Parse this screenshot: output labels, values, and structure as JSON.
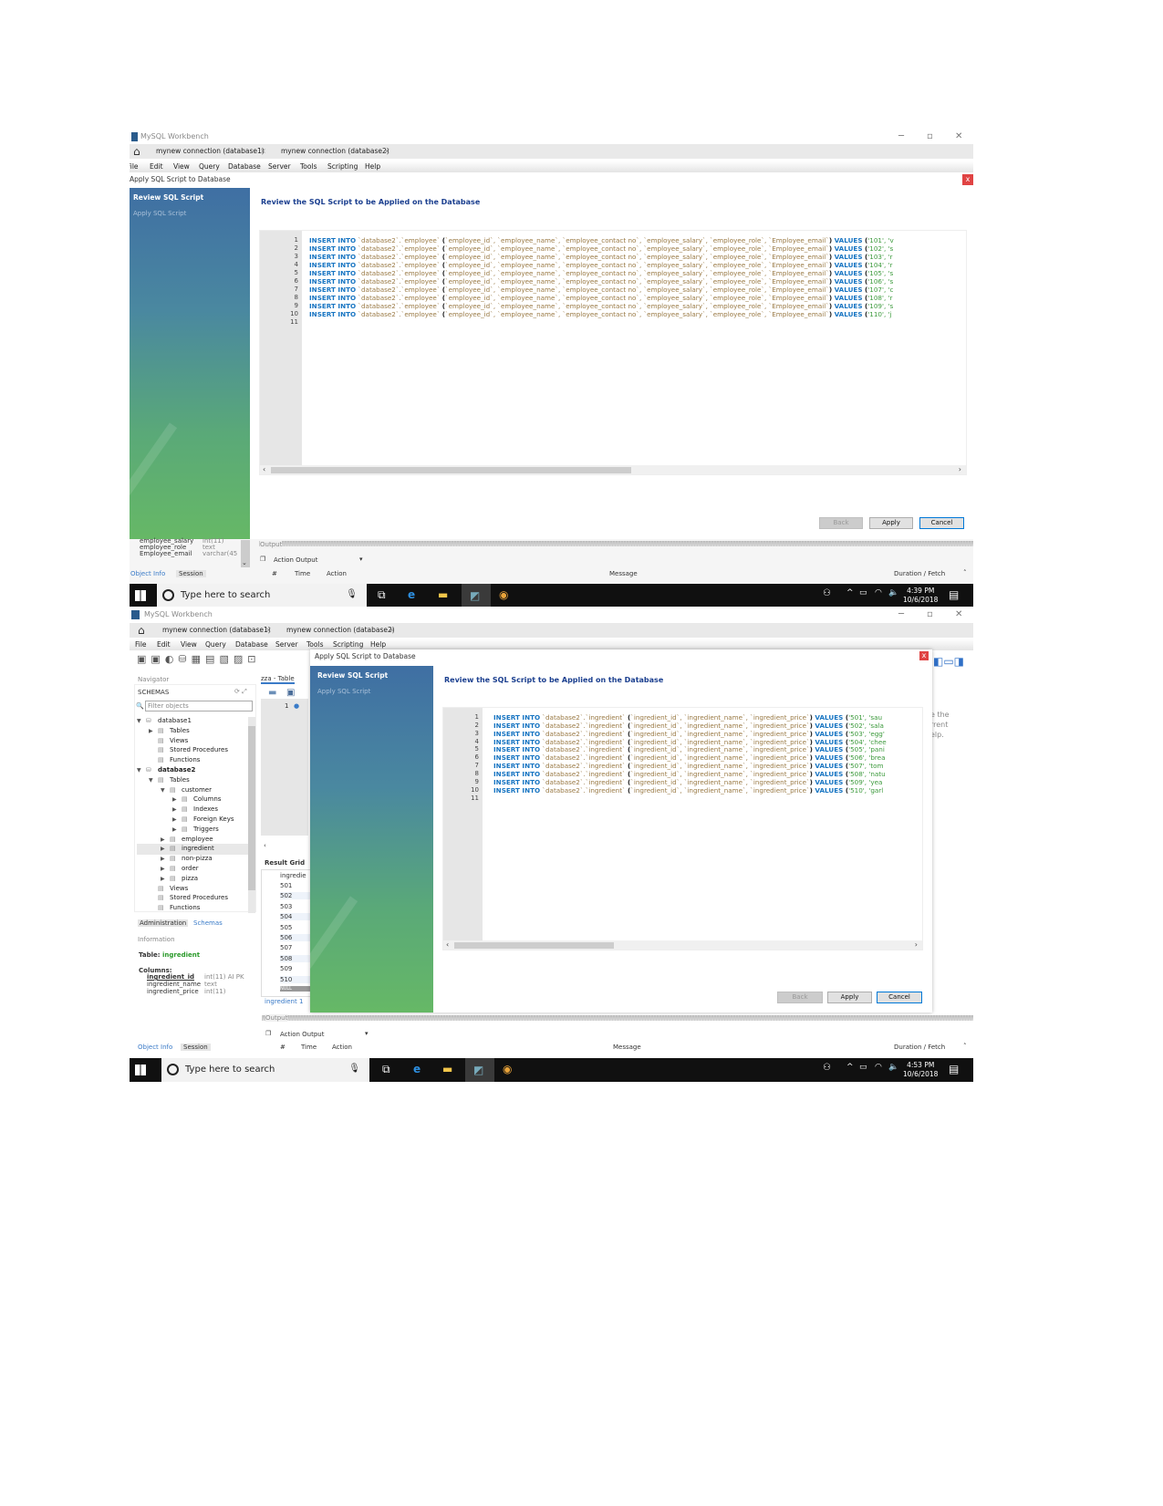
{
  "screenshots": [
    {
      "window_title": "MySQL Workbench",
      "tabs": [
        "mynew connection (database1)",
        "mynew connection (database2)"
      ],
      "menu": [
        "File",
        "Edit",
        "View",
        "Query",
        "Database",
        "Server",
        "Tools",
        "Scripting",
        "Help"
      ],
      "dialog": {
        "title": "Apply SQL Script to Database",
        "steps": [
          "Review SQL Script",
          "Apply SQL Script"
        ],
        "heading": "Review the SQL Script to be Applied on the Database",
        "code": {
          "lines": [
            {
              "n": "1",
              "kw": "INSERT INTO",
              "target": " `database2`.`employee` ",
              "cols": "`employee_id`, `employee_name`, `employee_contact no`, `employee_salary`, `employee_role`, `Employee_email`",
              "values_kw": " VALUES ",
              "vals": "'101', 'v"
            },
            {
              "n": "2",
              "kw": "INSERT INTO",
              "target": " `database2`.`employee` ",
              "cols": "`employee_id`, `employee_name`, `employee_contact no`, `employee_salary`, `employee_role`, `Employee_email`",
              "values_kw": " VALUES ",
              "vals": "'102', 's"
            },
            {
              "n": "3",
              "kw": "INSERT INTO",
              "target": " `database2`.`employee` ",
              "cols": "`employee_id`, `employee_name`, `employee_contact no`, `employee_salary`, `employee_role`, `Employee_email`",
              "values_kw": " VALUES ",
              "vals": "'103', 'r"
            },
            {
              "n": "4",
              "kw": "INSERT INTO",
              "target": " `database2`.`employee` ",
              "cols": "`employee_id`, `employee_name`, `employee_contact no`, `employee_salary`, `employee_role`, `Employee_email`",
              "values_kw": " VALUES ",
              "vals": "'104', 'r"
            },
            {
              "n": "5",
              "kw": "INSERT INTO",
              "target": " `database2`.`employee` ",
              "cols": "`employee_id`, `employee_name`, `employee_contact no`, `employee_salary`, `employee_role`, `Employee_email`",
              "values_kw": " VALUES ",
              "vals": "'105', 's"
            },
            {
              "n": "6",
              "kw": "INSERT INTO",
              "target": " `database2`.`employee` ",
              "cols": "`employee_id`, `employee_name`, `employee_contact no`, `employee_salary`, `employee_role`, `Employee_email`",
              "values_kw": " VALUES ",
              "vals": "'106', 's"
            },
            {
              "n": "7",
              "kw": "INSERT INTO",
              "target": " `database2`.`employee` ",
              "cols": "`employee_id`, `employee_name`, `employee_contact no`, `employee_salary`, `employee_role`, `Employee_email`",
              "values_kw": " VALUES ",
              "vals": "'107', 'c"
            },
            {
              "n": "8",
              "kw": "INSERT INTO",
              "target": " `database2`.`employee` ",
              "cols": "`employee_id`, `employee_name`, `employee_contact no`, `employee_salary`, `employee_role`, `Employee_email`",
              "values_kw": " VALUES ",
              "vals": "'108', 'r"
            },
            {
              "n": "9",
              "kw": "INSERT INTO",
              "target": " `database2`.`employee` ",
              "cols": "`employee_id`, `employee_name`, `employee_contact no`, `employee_salary`, `employee_role`, `Employee_email`",
              "values_kw": " VALUES ",
              "vals": "'109', 's"
            },
            {
              "n": "10",
              "kw": "INSERT INTO",
              "target": " `database2`.`employee` ",
              "cols": "`employee_id`, `employee_name`, `employee_contact no`, `employee_salary`, `employee_role`, `Employee_email`",
              "values_kw": " VALUES ",
              "vals": "'110', 'j"
            },
            {
              "n": "11"
            }
          ]
        },
        "buttons": {
          "back": "Back",
          "apply": "Apply",
          "cancel": "Cancel"
        },
        "close": "x"
      },
      "object_info": {
        "columns": [
          {
            "name": "employee_salary",
            "type": "int(11)"
          },
          {
            "name": "employee_role",
            "type": "text"
          },
          {
            "name": "Employee_email",
            "type": "varchar(45"
          }
        ],
        "tabs": [
          "Object Info",
          "Session"
        ]
      },
      "output": {
        "label": "Output",
        "selector": "Action Output",
        "columns": [
          "#",
          "Time",
          "Action",
          "Message",
          "Duration / Fetch"
        ]
      },
      "taskbar": {
        "search_placeholder": "Type here to search",
        "time": "4:39 PM",
        "date": "10/6/2018"
      }
    },
    {
      "window_title": "MySQL Workbench",
      "tabs": [
        "mynew connection (database1)",
        "mynew connection (database2)"
      ],
      "menu": [
        "File",
        "Edit",
        "View",
        "Query",
        "Database",
        "Server",
        "Tools",
        "Scripting",
        "Help"
      ],
      "navigator": {
        "label": "Navigator",
        "schemas_label": "SCHEMAS",
        "filter_placeholder": "Filter objects",
        "tree": [
          {
            "label": "database1",
            "level": 0,
            "arrow": "▼",
            "icon": "database-icon"
          },
          {
            "label": "Tables",
            "level": 1,
            "arrow": "▶",
            "icon": "tables-icon"
          },
          {
            "label": "Views",
            "level": 1,
            "arrow": "",
            "icon": "views-icon"
          },
          {
            "label": "Stored Procedures",
            "level": 1,
            "arrow": "",
            "icon": "procedures-icon"
          },
          {
            "label": "Functions",
            "level": 1,
            "arrow": "",
            "icon": "functions-icon"
          },
          {
            "label": "database2",
            "level": 0,
            "arrow": "▼",
            "icon": "database-icon",
            "bold": true
          },
          {
            "label": "Tables",
            "level": 1,
            "arrow": "▼",
            "icon": "tables-icon"
          },
          {
            "label": "customer",
            "level": 2,
            "arrow": "▼",
            "icon": "table-icon"
          },
          {
            "label": "Columns",
            "level": 3,
            "arrow": "▶",
            "icon": "columns-icon"
          },
          {
            "label": "Indexes",
            "level": 3,
            "arrow": "▶",
            "icon": "indexes-icon"
          },
          {
            "label": "Foreign Keys",
            "level": 3,
            "arrow": "▶",
            "icon": "foreign-keys-icon"
          },
          {
            "label": "Triggers",
            "level": 3,
            "arrow": "▶",
            "icon": "triggers-icon"
          },
          {
            "label": "employee",
            "level": 2,
            "arrow": "▶",
            "icon": "table-icon"
          },
          {
            "label": "ingredient",
            "level": 2,
            "arrow": "▶",
            "icon": "table-icon",
            "selected": true
          },
          {
            "label": "non-pizza",
            "level": 2,
            "arrow": "▶",
            "icon": "table-icon"
          },
          {
            "label": "order",
            "level": 2,
            "arrow": "▶",
            "icon": "table-icon"
          },
          {
            "label": "pizza",
            "level": 2,
            "arrow": "▶",
            "icon": "table-icon"
          },
          {
            "label": "Views",
            "level": 1,
            "arrow": "",
            "icon": "views-icon"
          },
          {
            "label": "Stored Procedures",
            "level": 1,
            "arrow": "",
            "icon": "procedures-icon"
          },
          {
            "label": "Functions",
            "level": 1,
            "arrow": "",
            "icon": "functions-icon"
          }
        ],
        "bottom_tabs": [
          "Administration",
          "Schemas"
        ],
        "information_label": "Information",
        "table_label": "Table:",
        "table_name": "ingredient",
        "columns_label": "Columns:",
        "columns": [
          {
            "name": "ingredient_id",
            "type": "int(11) AI PK"
          },
          {
            "name": "ingredient_name",
            "type": "text"
          },
          {
            "name": "ingredient_price",
            "type": "int(11)"
          }
        ],
        "info_tabs": [
          "Object Info",
          "Session"
        ]
      },
      "editor": {
        "tab": "zza - Table",
        "line": "1",
        "result_grid_label": "Result Grid",
        "grid_header": "ingredie",
        "grid_rows": [
          "501",
          "502",
          "503",
          "504",
          "505",
          "506",
          "507",
          "508",
          "509",
          "510",
          "NULL"
        ],
        "footer_tab": "ingredient 1"
      },
      "side_text": [
        "e the",
        "rrent",
        "elp."
      ],
      "dialog": {
        "title": "Apply SQL Script to Database",
        "steps": [
          "Review SQL Script",
          "Apply SQL Script"
        ],
        "heading": "Review the SQL Script to be Applied on the Database",
        "code": {
          "lines": [
            {
              "n": "1",
              "kw": "INSERT INTO",
              "target": " `database2`.`ingredient` ",
              "cols": "`ingredient_id`, `ingredient_name`, `ingredient_price`",
              "values_kw": " VALUES ",
              "vals": "'501', 'sau"
            },
            {
              "n": "2",
              "kw": "INSERT INTO",
              "target": " `database2`.`ingredient` ",
              "cols": "`ingredient_id`, `ingredient_name`, `ingredient_price`",
              "values_kw": " VALUES ",
              "vals": "'502', 'sala"
            },
            {
              "n": "3",
              "kw": "INSERT INTO",
              "target": " `database2`.`ingredient` ",
              "cols": "`ingredient_id`, `ingredient_name`, `ingredient_price`",
              "values_kw": " VALUES ",
              "vals": "'503', 'egg'"
            },
            {
              "n": "4",
              "kw": "INSERT INTO",
              "target": " `database2`.`ingredient` ",
              "cols": "`ingredient_id`, `ingredient_name`, `ingredient_price`",
              "values_kw": " VALUES ",
              "vals": "'504', 'chee"
            },
            {
              "n": "5",
              "kw": "INSERT INTO",
              "target": " `database2`.`ingredient` ",
              "cols": "`ingredient_id`, `ingredient_name`, `ingredient_price`",
              "values_kw": " VALUES ",
              "vals": "'505', 'pani"
            },
            {
              "n": "6",
              "kw": "INSERT INTO",
              "target": " `database2`.`ingredient` ",
              "cols": "`ingredient_id`, `ingredient_name`, `ingredient_price`",
              "values_kw": " VALUES ",
              "vals": "'506', 'brea"
            },
            {
              "n": "7",
              "kw": "INSERT INTO",
              "target": " `database2`.`ingredient` ",
              "cols": "`ingredient_id`, `ingredient_name`, `ingredient_price`",
              "values_kw": " VALUES ",
              "vals": "'507', 'tom"
            },
            {
              "n": "8",
              "kw": "INSERT INTO",
              "target": " `database2`.`ingredient` ",
              "cols": "`ingredient_id`, `ingredient_name`, `ingredient_price`",
              "values_kw": " VALUES ",
              "vals": "'508', 'natu"
            },
            {
              "n": "9",
              "kw": "INSERT INTO",
              "target": " `database2`.`ingredient` ",
              "cols": "`ingredient_id`, `ingredient_name`, `ingredient_price`",
              "values_kw": " VALUES ",
              "vals": "'509', 'yea"
            },
            {
              "n": "10",
              "kw": "INSERT INTO",
              "target": " `database2`.`ingredient` ",
              "cols": "`ingredient_id`, `ingredient_name`, `ingredient_price`",
              "values_kw": " VALUES ",
              "vals": "'510', 'garl"
            },
            {
              "n": "11"
            }
          ]
        },
        "buttons": {
          "back": "Back",
          "apply": "Apply",
          "cancel": "Cancel"
        },
        "close": "x"
      },
      "output": {
        "label": "Output",
        "selector": "Action Output",
        "columns": [
          "#",
          "Time",
          "Action",
          "Message",
          "Duration / Fetch"
        ]
      },
      "taskbar": {
        "search_placeholder": "Type here to search",
        "time": "4:53 PM",
        "date": "10/6/2018"
      }
    }
  ]
}
